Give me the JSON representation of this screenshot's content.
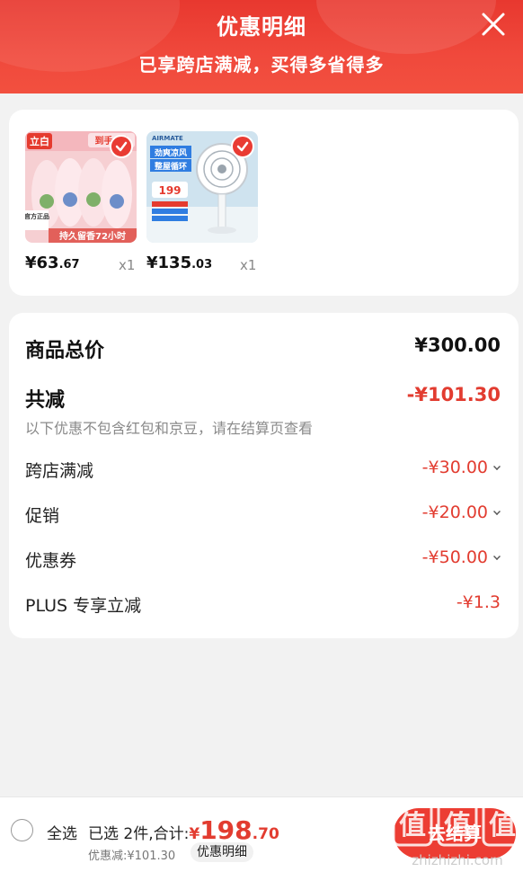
{
  "header": {
    "title": "优惠明细",
    "subtitle": "已享跨店满减，买得多省得多"
  },
  "products": [
    {
      "price_int": "¥63",
      "price_dec": ".67",
      "qty": "x1",
      "image_text": [
        "立白",
        "到手0斤",
        "官方正品",
        "持久留香72小时"
      ]
    },
    {
      "price_int": "¥135",
      "price_dec": ".03",
      "qty": "x1",
      "image_text": [
        "AIRMATE",
        "劲爽凉风",
        "整屋循环",
        "199"
      ]
    }
  ],
  "details": {
    "total_label": "商品总价",
    "total_value": "¥300.00",
    "reduce_label": "共减",
    "reduce_value": "-¥101.30",
    "note": "以下优惠不包含红包和京豆，请在结算页查看",
    "items": [
      {
        "label": "跨店满减",
        "value": "-¥30.00"
      },
      {
        "label": "促销",
        "value": "-¥20.00"
      },
      {
        "label": "优惠券",
        "value": "-¥50.00"
      },
      {
        "label": "PLUS 专享立减",
        "value": "-¥1.3"
      }
    ]
  },
  "bottom": {
    "select_all": "全选",
    "summary_prefix": "已选 2件,合计:",
    "total_yen": "¥",
    "total_int": "198",
    "total_dec": ".70",
    "discount": "优惠减:¥101.30",
    "detail_chip": "优惠明细",
    "checkout": "去结算"
  },
  "watermark": {
    "brand": "值",
    "site": "zhizhizhi.com"
  },
  "colors": {
    "accent": "#e93b33",
    "header": "#f0493c",
    "price_red": "#e23c30"
  }
}
